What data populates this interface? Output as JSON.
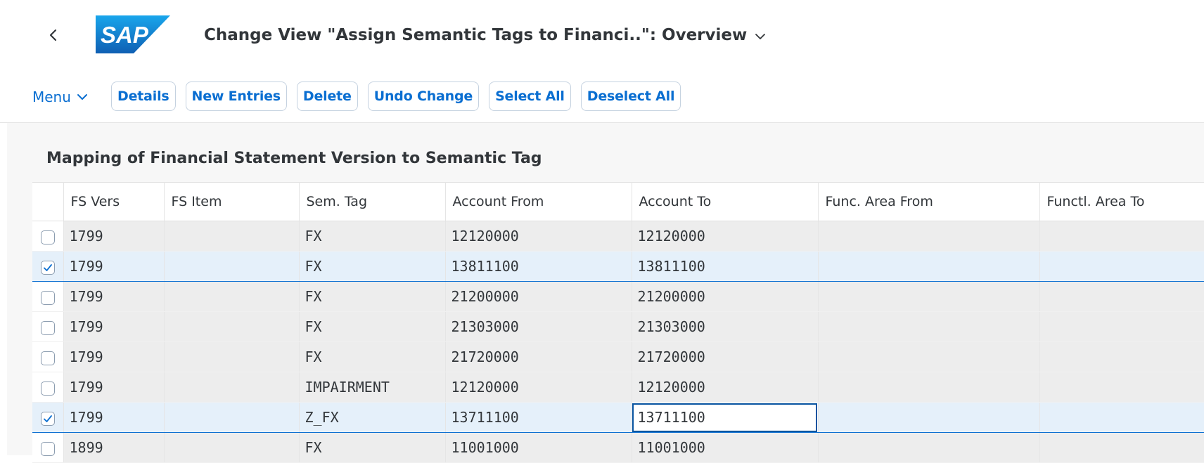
{
  "shell": {
    "logo_text": "SAP",
    "title": "Change View \"Assign Semantic Tags to Financi..\": Overview"
  },
  "toolbar": {
    "menu_label": "Menu",
    "buttons": {
      "details": "Details",
      "new_entries": "New Entries",
      "delete": "Delete",
      "undo_change": "Undo Change",
      "select_all": "Select All",
      "deselect_all": "Deselect All"
    }
  },
  "table": {
    "title": "Mapping of Financial Statement Version to Semantic Tag",
    "columns": {
      "fs_vers": "FS Vers",
      "fs_item": "FS Item",
      "sem_tag": "Sem. Tag",
      "account_from": "Account From",
      "account_to": "Account To",
      "func_area_from": "Func. Area From",
      "func_area_to": "Functl. Area To"
    },
    "rows": [
      {
        "checked": false,
        "fs_vers": "1799",
        "fs_item": "",
        "sem_tag": "FX",
        "account_from": "12120000",
        "account_to": "12120000",
        "func_area_from": "",
        "func_area_to": ""
      },
      {
        "checked": true,
        "fs_vers": "1799",
        "fs_item": "",
        "sem_tag": "FX",
        "account_from": "13811100",
        "account_to": "13811100",
        "func_area_from": "",
        "func_area_to": ""
      },
      {
        "checked": false,
        "fs_vers": "1799",
        "fs_item": "",
        "sem_tag": "FX",
        "account_from": "21200000",
        "account_to": "21200000",
        "func_area_from": "",
        "func_area_to": ""
      },
      {
        "checked": false,
        "fs_vers": "1799",
        "fs_item": "",
        "sem_tag": "FX",
        "account_from": "21303000",
        "account_to": "21303000",
        "func_area_from": "",
        "func_area_to": ""
      },
      {
        "checked": false,
        "fs_vers": "1799",
        "fs_item": "",
        "sem_tag": "FX",
        "account_from": "21720000",
        "account_to": "21720000",
        "func_area_from": "",
        "func_area_to": ""
      },
      {
        "checked": false,
        "fs_vers": "1799",
        "fs_item": "",
        "sem_tag": "IMPAIRMENT",
        "account_from": "12120000",
        "account_to": "12120000",
        "func_area_from": "",
        "func_area_to": ""
      },
      {
        "checked": true,
        "fs_vers": "1799",
        "fs_item": "",
        "sem_tag": "Z_FX",
        "account_from": "13711100",
        "account_to": "13711100",
        "func_area_from": "",
        "func_area_to": ""
      },
      {
        "checked": false,
        "fs_vers": "1899",
        "fs_item": "",
        "sem_tag": "FX",
        "account_from": "11001000",
        "account_to": "11001000",
        "func_area_from": "",
        "func_area_to": ""
      }
    ]
  },
  "colors": {
    "accent": "#0a6ed1",
    "selected_row": "#e5f0fa",
    "cell_bg": "#ededed",
    "sap_blue": "#1a73c8"
  },
  "icons": {
    "back": "chevron-left-icon",
    "title_dropdown": "chevron-down-icon",
    "menu_dropdown": "chevron-down-icon",
    "checkbox_checked": "checkmark-icon"
  }
}
